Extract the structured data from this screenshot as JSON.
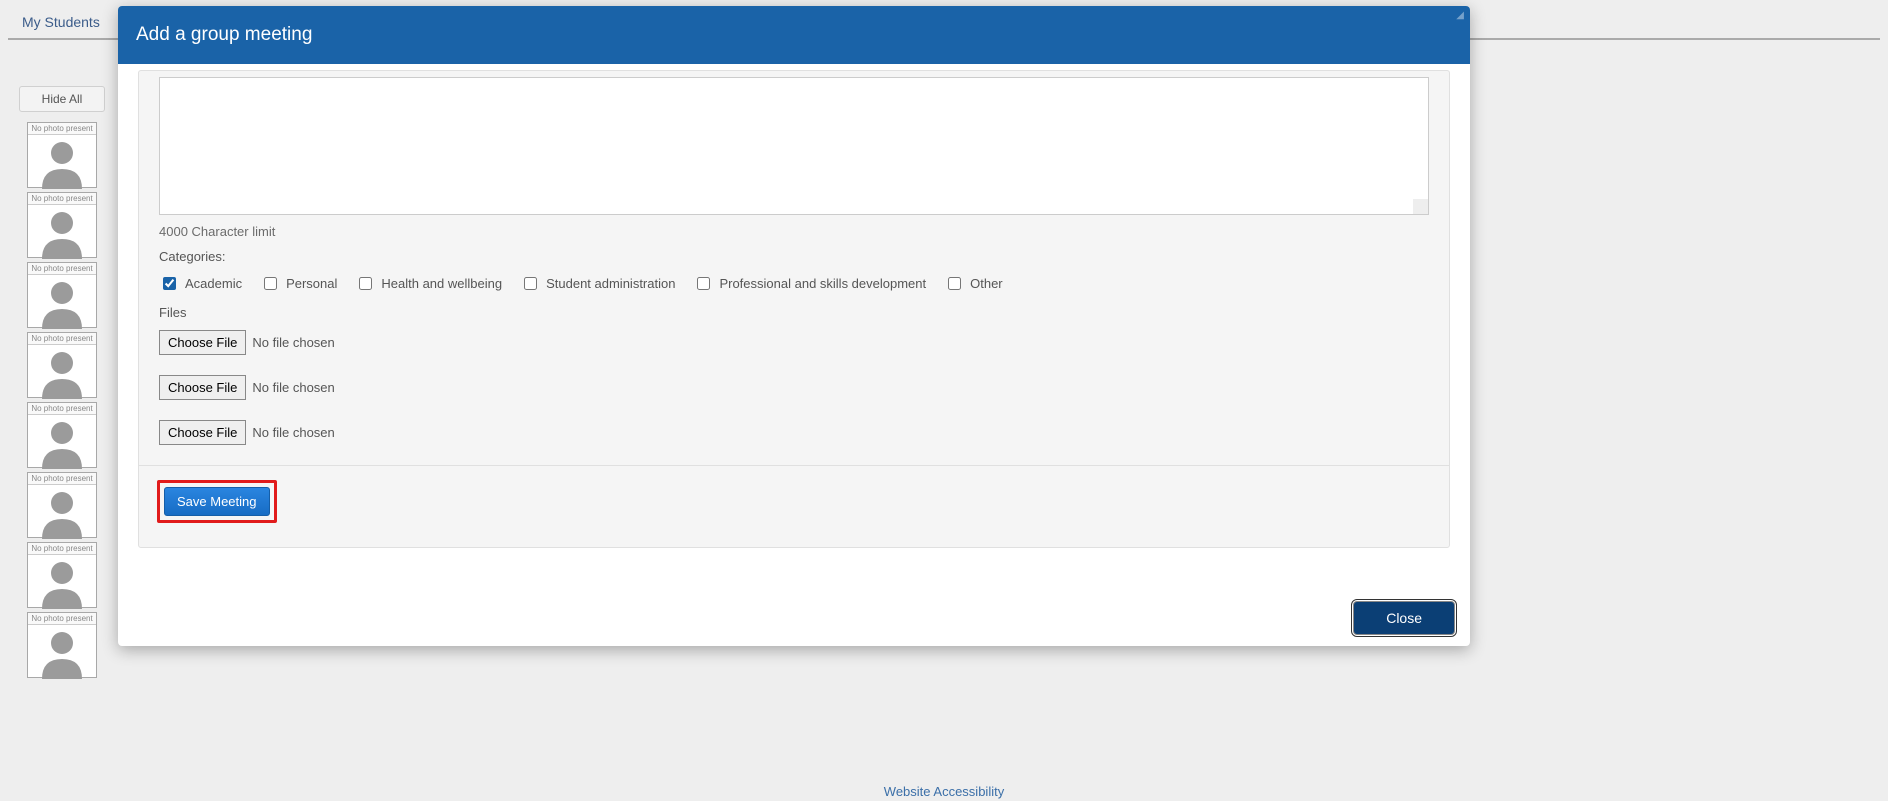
{
  "nav": {
    "my_students": "My Students"
  },
  "sidebar": {
    "hide_all": "Hide All",
    "no_photo": "No photo present"
  },
  "footer": {
    "accessibility": "Website Accessibility"
  },
  "modal": {
    "title": "Add a group meeting",
    "char_limit": "4000 Character limit",
    "categories_label": "Categories:",
    "categories": [
      {
        "label": "Academic",
        "checked": true
      },
      {
        "label": "Personal",
        "checked": false
      },
      {
        "label": "Health and wellbeing",
        "checked": false
      },
      {
        "label": "Student administration",
        "checked": false
      },
      {
        "label": "Professional and skills development",
        "checked": false
      },
      {
        "label": "Other",
        "checked": false
      }
    ],
    "files_label": "Files",
    "choose_file": "Choose File",
    "no_file": "No file chosen",
    "save": "Save Meeting",
    "close": "Close"
  }
}
